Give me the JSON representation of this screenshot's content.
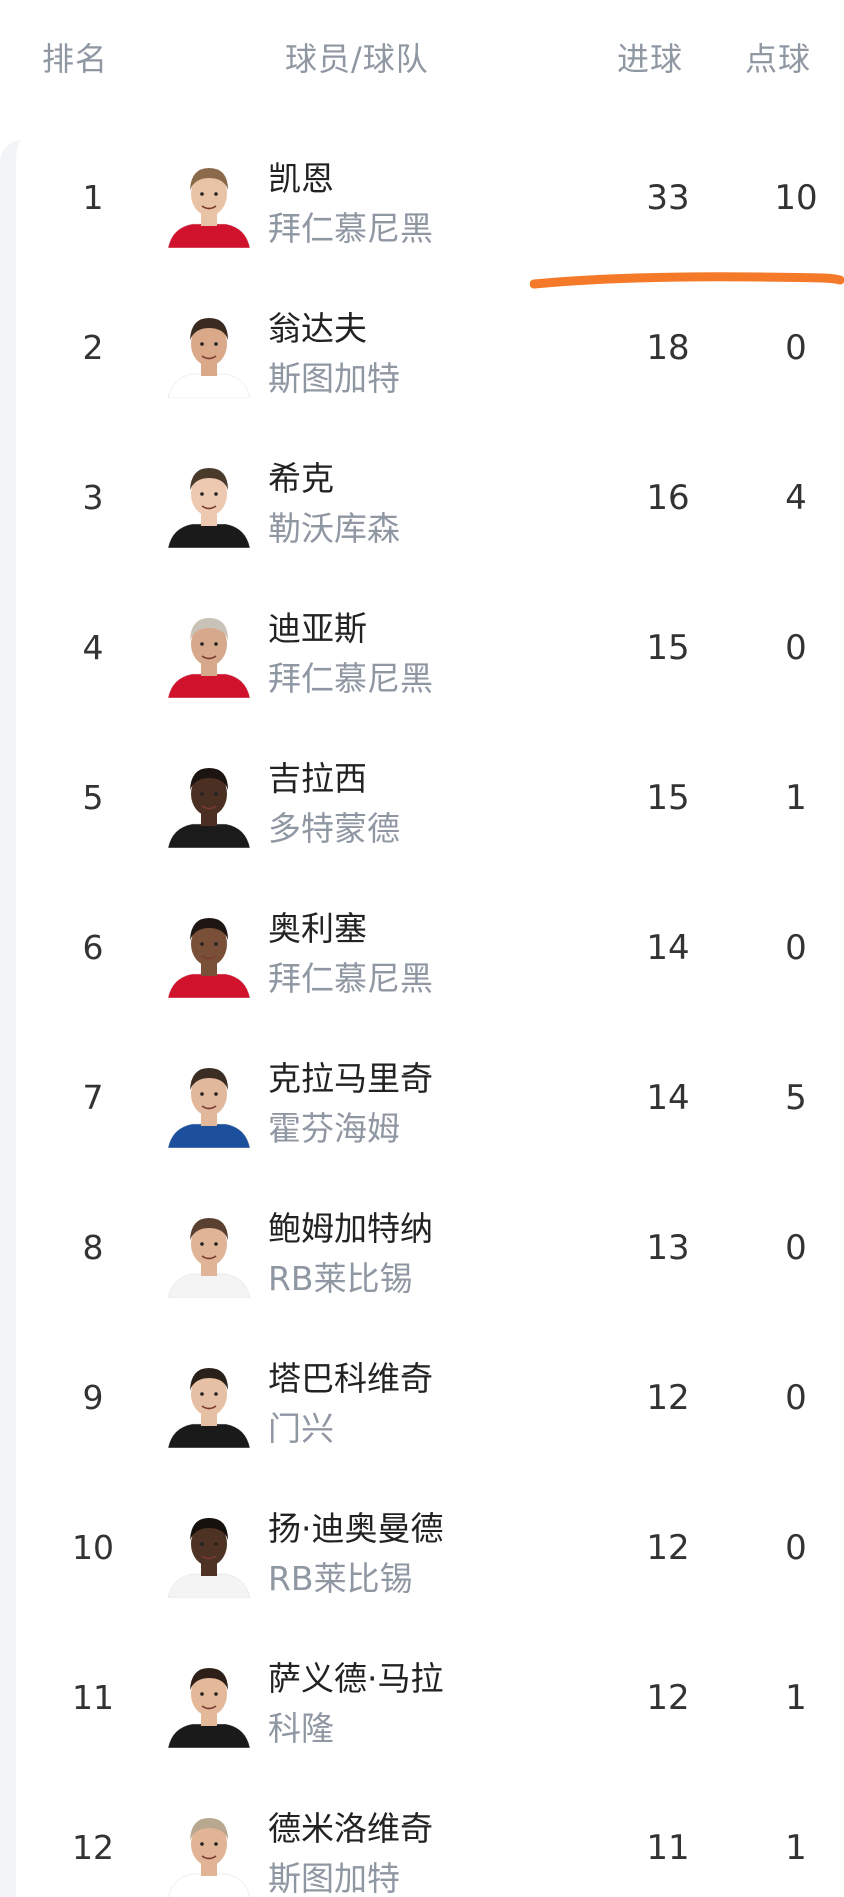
{
  "header": {
    "rank": "排名",
    "player_team": "球员/球队",
    "goals": "进球",
    "penalties": "点球"
  },
  "rows": [
    {
      "rank": "1",
      "name": "凯恩",
      "team": "拜仁慕尼黑",
      "goals": "33",
      "penalties": "10",
      "kit": "#d0122c",
      "hair": "#8a6a4a",
      "skin": "#e9c3a6"
    },
    {
      "rank": "2",
      "name": "翁达夫",
      "team": "斯图加特",
      "goals": "18",
      "penalties": "0",
      "kit": "#ffffff",
      "hair": "#3a2a20",
      "skin": "#d9a98a"
    },
    {
      "rank": "3",
      "name": "希克",
      "team": "勒沃库森",
      "goals": "16",
      "penalties": "4",
      "kit": "#1a1a1a",
      "hair": "#4a3a2c",
      "skin": "#ecc9b0"
    },
    {
      "rank": "4",
      "name": "迪亚斯",
      "team": "拜仁慕尼黑",
      "goals": "15",
      "penalties": "0",
      "kit": "#d0122c",
      "hair": "#c9c2b8",
      "skin": "#d7a98c"
    },
    {
      "rank": "5",
      "name": "吉拉西",
      "team": "多特蒙德",
      "goals": "15",
      "penalties": "1",
      "kit": "#1b1b1b",
      "hair": "#1b1410",
      "skin": "#4a2f22"
    },
    {
      "rank": "6",
      "name": "奥利塞",
      "team": "拜仁慕尼黑",
      "goals": "14",
      "penalties": "0",
      "kit": "#d0122c",
      "hair": "#1e1612",
      "skin": "#7a4f38"
    },
    {
      "rank": "7",
      "name": "克拉马里奇",
      "team": "霍芬海姆",
      "goals": "14",
      "penalties": "5",
      "kit": "#1c4f9c",
      "hair": "#3b2d24",
      "skin": "#e2b89c"
    },
    {
      "rank": "8",
      "name": "鲍姆加特纳",
      "team": "RB莱比锡",
      "goals": "13",
      "penalties": "0",
      "kit": "#f4f4f4",
      "hair": "#5a4030",
      "skin": "#e0b496"
    },
    {
      "rank": "9",
      "name": "塔巴科维奇",
      "team": "门兴",
      "goals": "12",
      "penalties": "0",
      "kit": "#1a1a1a",
      "hair": "#2a201a",
      "skin": "#e6c0a4"
    },
    {
      "rank": "10",
      "name": "扬·迪奥曼德",
      "team": "RB莱比锡",
      "goals": "12",
      "penalties": "0",
      "kit": "#f4f4f4",
      "hair": "#17110d",
      "skin": "#4e3224"
    },
    {
      "rank": "11",
      "name": "萨义德·马拉",
      "team": "科隆",
      "goals": "12",
      "penalties": "1",
      "kit": "#1a1a1a",
      "hair": "#2e2018",
      "skin": "#e4b99a"
    },
    {
      "rank": "12",
      "name": "德米洛维奇",
      "team": "斯图加特",
      "goals": "11",
      "penalties": "1",
      "kit": "#ffffff",
      "hair": "#b8a890",
      "skin": "#e2b496"
    }
  ],
  "annotation_color": "#f47a2a"
}
